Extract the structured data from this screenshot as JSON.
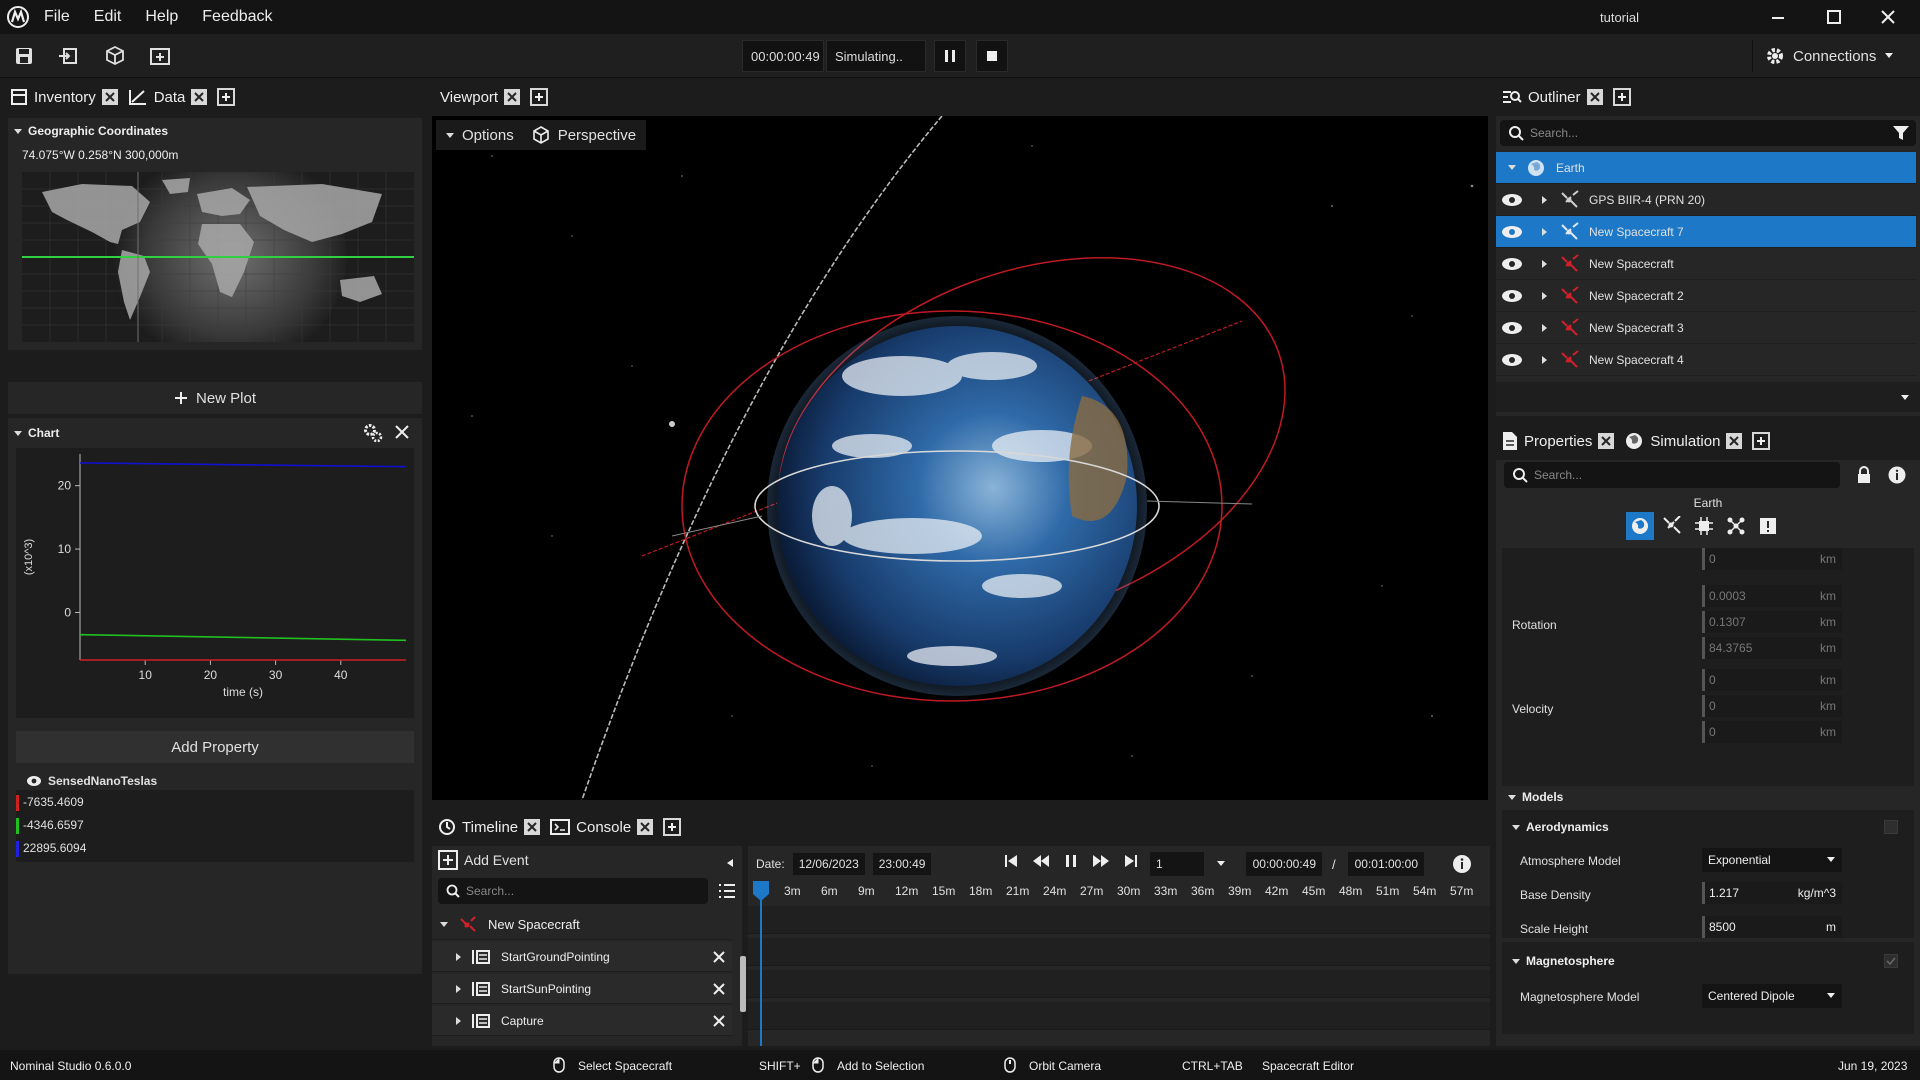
{
  "app": {
    "window_title": "tutorial",
    "version": "Nominal Studio 0.6.0.0"
  },
  "menu": [
    "File",
    "Edit",
    "Help",
    "Feedback"
  ],
  "toolbar": {
    "sim_time": "00:00:00:49",
    "sim_status": "Simulating..",
    "connections": "Connections"
  },
  "left_tabs": [
    "Inventory",
    "Data"
  ],
  "geo": {
    "title": "Geographic Coordinates",
    "coords": "74.075°W 0.258°N 300,000m"
  },
  "new_plot": "New Plot",
  "chart_panel": {
    "title": "Chart",
    "add_property": "Add Property",
    "property_name": "SensedNanoTeslas",
    "values": [
      "-7635.4609",
      "-4346.6597",
      "22895.6094"
    ]
  },
  "chart_data": {
    "type": "line",
    "xlabel": "time (s)",
    "ylabel": "(x10^3)",
    "xlim": [
      0,
      50
    ],
    "ylim": [
      -7.5,
      25
    ],
    "xticks": [
      "10",
      "20",
      "30",
      "40"
    ],
    "yticks": [
      "0",
      "10",
      "20"
    ],
    "series": [
      {
        "color": "#1010d0",
        "x": [
          0,
          50
        ],
        "y": [
          23.6,
          23.0
        ]
      },
      {
        "color": "#20c020",
        "x": [
          0,
          50
        ],
        "y": [
          -3.5,
          -4.4
        ]
      },
      {
        "color": "#d02020",
        "x": [
          0,
          50
        ],
        "y": [
          -8.6,
          -7.6
        ]
      }
    ]
  },
  "viewport": {
    "tab": "Viewport",
    "options": "Options",
    "perspective": "Perspective"
  },
  "outliner": {
    "tab": "Outliner",
    "search_placeholder": "Search...",
    "root": "Earth",
    "items": [
      "GPS BIIR-4 (PRN 20)",
      "New Spacecraft 7",
      "New Spacecraft",
      "New Spacecraft 2",
      "New Spacecraft 3",
      "New Spacecraft 4"
    ]
  },
  "properties": {
    "tabs": [
      "Properties",
      "Simulation"
    ],
    "search_placeholder": "Search...",
    "object": "Earth",
    "rotation_label": "Rotation",
    "velocity_label": "Velocity",
    "fields_top": [
      "0"
    ],
    "rotation": [
      "0.0003",
      "0.1307",
      "84.3765"
    ],
    "velocity": [
      "0",
      "0",
      "0"
    ],
    "unit": "km",
    "models": "Models",
    "aerodynamics": "Aerodynamics",
    "atmosphere_label": "Atmosphere Model",
    "atmosphere_value": "Exponential",
    "base_density_label": "Base Density",
    "base_density_value": "1.217",
    "base_density_unit": "kg/m^3",
    "scale_height_label": "Scale Height",
    "scale_height_value": "8500",
    "scale_height_unit": "m",
    "magnetosphere": "Magnetosphere",
    "mag_model_label": "Magnetosphere Model",
    "mag_model_value": "Centered Dipole"
  },
  "timeline": {
    "tabs": [
      "Timeline",
      "Console"
    ],
    "add_event": "Add Event",
    "search_placeholder": "Search...",
    "date_label": "Date:",
    "date": "12/06/2023",
    "time": "23:00:49",
    "speed": "1",
    "current": "00:00:00:49",
    "sep": "/",
    "total": "00:01:00:00",
    "ticks": [
      "3m",
      "6m",
      "9m",
      "12m",
      "15m",
      "18m",
      "21m",
      "24m",
      "27m",
      "30m",
      "33m",
      "36m",
      "39m",
      "42m",
      "45m",
      "48m",
      "51m",
      "54m",
      "57m"
    ],
    "root": "New Spacecraft",
    "events": [
      "StartGroundPointing",
      "StartSunPointing",
      "Capture"
    ]
  },
  "status": {
    "select": "Select Spacecraft",
    "shift": "SHIFT+",
    "add_sel": "Add to Selection",
    "orbit": "Orbit Camera",
    "ctrl": "CTRL+TAB",
    "editor": "Spacecraft Editor",
    "date": "Jun 19, 2023"
  },
  "colors": {
    "accent": "#1e78c8",
    "spacecraft_red": "#d0202a",
    "panel": "#262626"
  }
}
